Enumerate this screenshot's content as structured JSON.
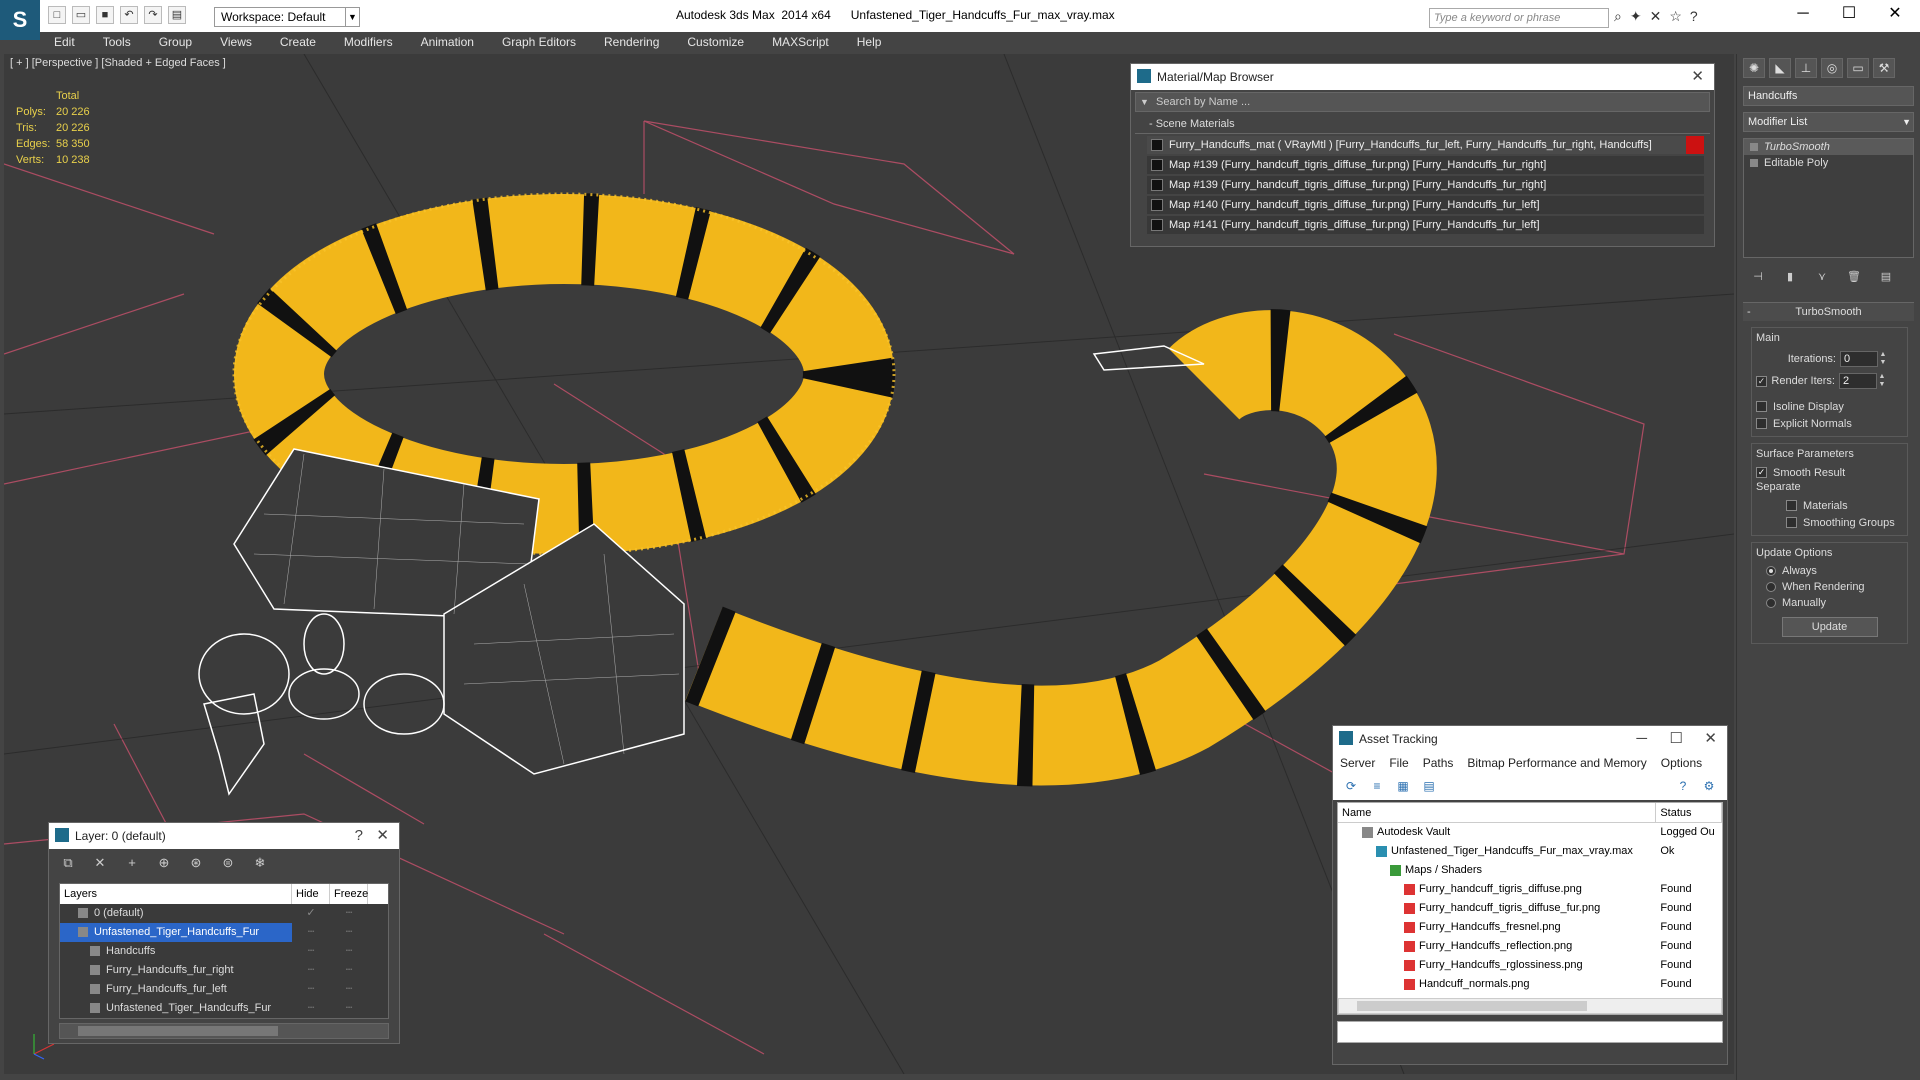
{
  "app": {
    "title": "Autodesk 3ds Max  2014 x64      Unfastened_Tiger_Handcuffs_Fur_max_vray.max",
    "workspace": "Workspace: Default",
    "search_placeholder": "Type a keyword or phrase"
  },
  "menu": [
    "Edit",
    "Tools",
    "Group",
    "Views",
    "Create",
    "Modifiers",
    "Animation",
    "Graph Editors",
    "Rendering",
    "Customize",
    "MAXScript",
    "Help"
  ],
  "viewport": {
    "label": "[ + ] [Perspective ] [Shaded + Edged Faces ]",
    "stats": {
      "header": "Total",
      "rows": [
        {
          "k": "Polys:",
          "v": "20 226"
        },
        {
          "k": "Tris:",
          "v": "20 226"
        },
        {
          "k": "Edges:",
          "v": "58 350"
        },
        {
          "k": "Verts:",
          "v": "10 238"
        }
      ]
    }
  },
  "material_browser": {
    "title": "Material/Map Browser",
    "search": "Search by Name ...",
    "section": "- Scene Materials",
    "items": [
      "Furry_Handcuffs_mat  ( VRayMtl ) [Furry_Handcuffs_fur_left, Furry_Handcuffs_fur_right, Handcuffs]",
      "Map #139 (Furry_handcuff_tigris_diffuse_fur.png) [Furry_Handcuffs_fur_right]",
      "Map #139 (Furry_handcuff_tigris_diffuse_fur.png) [Furry_Handcuffs_fur_right]",
      "Map #140 (Furry_handcuff_tigris_diffuse_fur.png) [Furry_Handcuffs_fur_left]",
      "Map #141 (Furry_handcuff_tigris_diffuse_fur.png) [Furry_Handcuffs_fur_left]"
    ]
  },
  "command_panel": {
    "object_name": "Handcuffs",
    "modifier_list": "Modifier List",
    "stack": [
      "TurboSmooth",
      "Editable Poly"
    ],
    "rollout_title": "TurboSmooth",
    "main_label": "Main",
    "iterations_label": "Iterations:",
    "iterations_value": "0",
    "render_iters_label": "Render Iters:",
    "render_iters_value": "2",
    "isoline": "Isoline Display",
    "explicit_normals": "Explicit Normals",
    "surface_params": "Surface Parameters",
    "smooth_result": "Smooth Result",
    "separate": "Separate",
    "materials": "Materials",
    "smoothing_groups": "Smoothing Groups",
    "update_options": "Update Options",
    "always": "Always",
    "when_rendering": "When Rendering",
    "manually": "Manually",
    "update_button": "Update"
  },
  "layer_window": {
    "title": "Layer: 0 (default)",
    "col_layers": "Layers",
    "col_hide": "Hide",
    "col_freeze": "Freeze",
    "rows": [
      {
        "name": "0 (default)",
        "indent": 1
      },
      {
        "name": "Unfastened_Tiger_Handcuffs_Fur",
        "indent": 1
      },
      {
        "name": "Handcuffs",
        "indent": 2
      },
      {
        "name": "Furry_Handcuffs_fur_right",
        "indent": 2
      },
      {
        "name": "Furry_Handcuffs_fur_left",
        "indent": 2
      },
      {
        "name": "Unfastened_Tiger_Handcuffs_Fur",
        "indent": 2
      }
    ]
  },
  "asset_tracking": {
    "title": "Asset Tracking",
    "menu": [
      "Server",
      "File",
      "Paths",
      "Bitmap Performance and Memory",
      "Options"
    ],
    "col_name": "Name",
    "col_status": "Status",
    "rows": [
      {
        "name": "Autodesk Vault",
        "status": "Logged Ou"
      },
      {
        "name": "Unfastened_Tiger_Handcuffs_Fur_max_vray.max",
        "status": "Ok"
      },
      {
        "name": "Maps / Shaders",
        "status": ""
      },
      {
        "name": "Furry_handcuff_tigris_diffuse.png",
        "status": "Found"
      },
      {
        "name": "Furry_handcuff_tigris_diffuse_fur.png",
        "status": "Found"
      },
      {
        "name": "Furry_Handcuffs_fresnel.png",
        "status": "Found"
      },
      {
        "name": "Furry_Handcuffs_reflection.png",
        "status": "Found"
      },
      {
        "name": "Furry_Handcuffs_rglossiness.png",
        "status": "Found"
      },
      {
        "name": "Handcuff_normals.png",
        "status": "Found"
      }
    ]
  },
  "colors": {
    "fur": "#f2b71a",
    "stripe": "#111111",
    "wire": "#ffffff",
    "grid_line": "#c0506a",
    "stats_text": "#e8d04b",
    "selection": "#2b66c8"
  }
}
